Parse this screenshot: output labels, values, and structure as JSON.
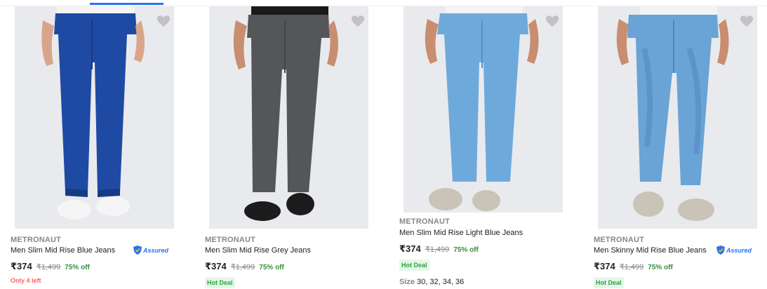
{
  "page": {
    "top_tab_text": "",
    "colors": {
      "accent": "#2874f0",
      "discount": "#388e3c",
      "stock": "#ff6161",
      "hot_deal_bg": "#e6f7e9",
      "hot_deal_text": "#26a541",
      "muted": "#878787"
    }
  },
  "products": [
    {
      "brand": "METRONAUT",
      "title": "Men Slim Mid Rise Blue Jeans",
      "price": "₹374",
      "mrp": "₹1,499",
      "discount": "75% off",
      "assured": "Assured",
      "stock": "Only 4 left",
      "jean_color": "#1f4aa3",
      "jean_shade": "#173a85",
      "shoe_color": "#f5f5f5",
      "icons": [
        "heart-icon",
        "assured-shield-icon"
      ]
    },
    {
      "brand": "METRONAUT",
      "title": "Men Slim Mid Rise Grey Jeans",
      "price": "₹374",
      "mrp": "₹1,499",
      "discount": "75% off",
      "hot_deal": "Hot Deal",
      "jean_color": "#555659",
      "jean_shade": "#434447",
      "shoe_color": "#1c1c1c",
      "icons": [
        "heart-icon"
      ]
    },
    {
      "brand": "METRONAUT",
      "title": "Men Slim Mid Rise Light Blue Jeans",
      "price": "₹374",
      "mrp": "₹1,499",
      "discount": "75% off",
      "hot_deal": "Hot Deal",
      "sizes_label": "Size",
      "sizes_value": "30, 32, 34, 36",
      "jean_color": "#6ea9dc",
      "jean_shade": "#5890c6",
      "shoe_color": "#c9c3b8",
      "icons": [
        "heart-icon"
      ]
    },
    {
      "brand": "METRONAUT",
      "title": "Men Skinny Mid Rise Blue Jeans",
      "price": "₹374",
      "mrp": "₹1,499",
      "discount": "75% off",
      "assured": "Assured",
      "hot_deal": "Hot Deal",
      "jean_color": "#6aa3d6",
      "jean_shade": "#4d86bd",
      "shoe_color": "#c9c3b8",
      "icons": [
        "heart-icon",
        "assured-shield-icon"
      ]
    }
  ]
}
